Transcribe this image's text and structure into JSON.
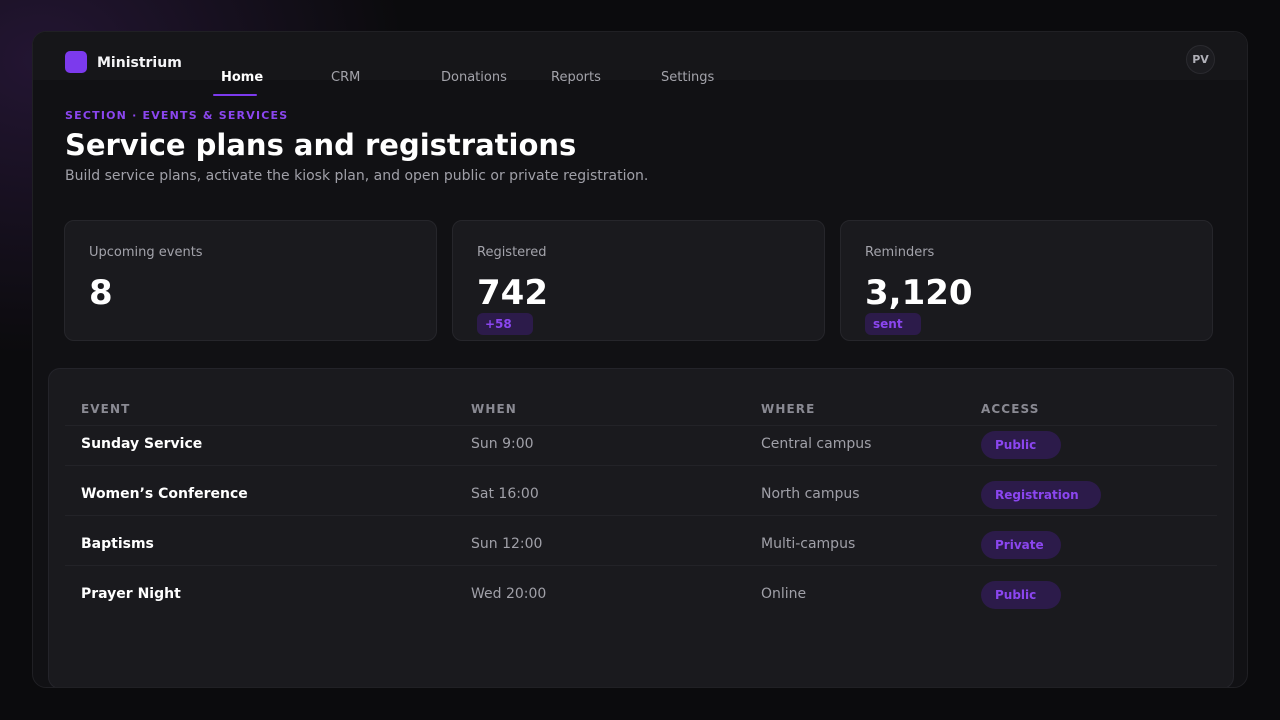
{
  "app": {
    "name": "Ministrium",
    "user_initials": "PV"
  },
  "nav": {
    "tabs": [
      {
        "label": "Home",
        "active": true
      },
      {
        "label": "CRM"
      },
      {
        "label": "Donations"
      },
      {
        "label": "Reports"
      },
      {
        "label": "Settings"
      }
    ]
  },
  "header": {
    "eyebrow": "SECTION · EVENTS & SERVICES",
    "title": "Service plans and registrations",
    "subtitle": "Build service plans, activate the kiosk plan, and open public or private registration."
  },
  "stats": [
    {
      "label": "Upcoming events",
      "value": "8",
      "badge": ""
    },
    {
      "label": "Registered",
      "value": "742",
      "badge": "+58"
    },
    {
      "label": "Reminders",
      "value": "3,120",
      "badge": "sent"
    }
  ],
  "table": {
    "columns": [
      "EVENT",
      "WHEN",
      "WHERE",
      "ACCESS"
    ],
    "rows": [
      {
        "event": "Sunday Service",
        "when": "Sun 9:00",
        "where": "Central campus",
        "access": "Public"
      },
      {
        "event": "Women’s Conference",
        "when": "Sat 16:00",
        "where": "North campus",
        "access": "Registration"
      },
      {
        "event": "Baptisms",
        "when": "Sun 12:00",
        "where": "Multi-campus",
        "access": "Private"
      },
      {
        "event": "Prayer Night",
        "when": "Wed 20:00",
        "where": "Online",
        "access": "Public"
      }
    ]
  },
  "colors": {
    "accent": "#7c3aed",
    "accent_text": "#8b46f0",
    "badge_bg": "#2c1b4a"
  }
}
